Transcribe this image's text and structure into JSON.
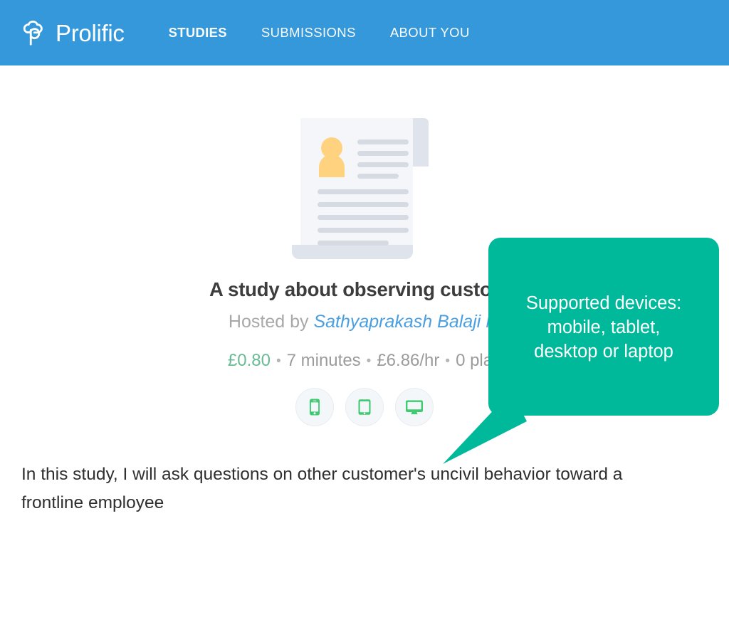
{
  "header": {
    "brand_name": "Prolific",
    "brand_logo_icon": "prolific-logo-icon",
    "background_color": "#3498db",
    "nav": [
      {
        "label": "STUDIES",
        "active": true
      },
      {
        "label": "SUBMISSIONS",
        "active": false
      },
      {
        "label": "ABOUT YOU",
        "active": false
      }
    ]
  },
  "study": {
    "illustration_icon": "document-with-person-illustration",
    "title": "A study about observing custome",
    "hosted_by_prefix": "Hosted by ",
    "host_name": "Sathyaprakash Balaji M",
    "reward": "£0.80",
    "duration": "7 minutes",
    "hourly_rate": "£6.86/hr",
    "places": "0 plac",
    "separator": "•",
    "reward_color": "#68bb94",
    "description": "In this study, I will ask questions on other customer's uncivil behavior toward a frontline employee"
  },
  "devices": [
    {
      "name": "mobile-device-icon",
      "label": "mobile"
    },
    {
      "name": "tablet-device-icon",
      "label": "tablet"
    },
    {
      "name": "desktop-device-icon",
      "label": "desktop"
    }
  ],
  "tooltip": {
    "text": "Supported devices:\nmobile, tablet,\ndesktop or laptop",
    "background_color": "#00b89a",
    "text_color": "#ffffff",
    "points_to": "desktop-device-icon"
  }
}
